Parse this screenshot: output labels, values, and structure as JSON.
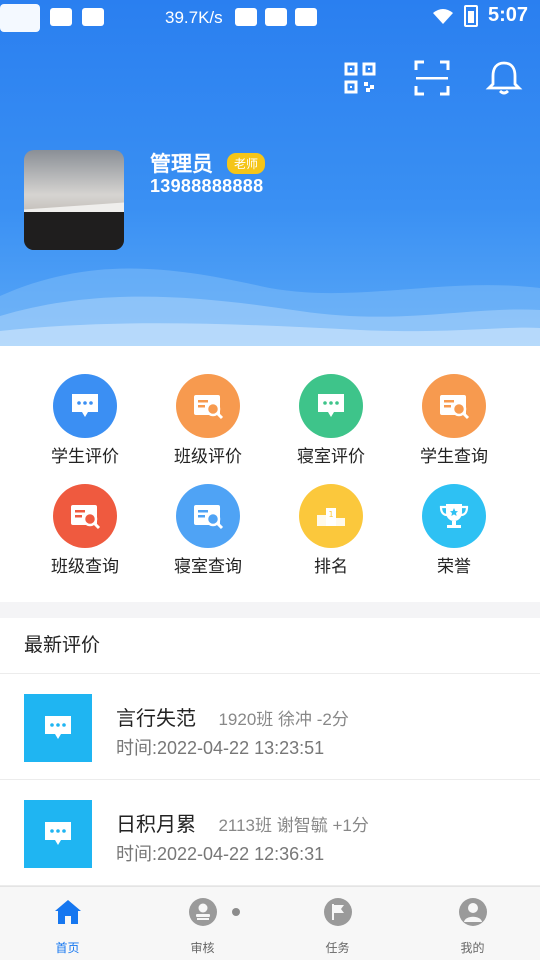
{
  "status_bar": {
    "speed": "39.7K/s",
    "time": "5:07"
  },
  "profile": {
    "name": "管理员",
    "role_badge": "老师",
    "phone": "13988888888"
  },
  "menu": [
    {
      "label": "学生评价",
      "icon": "chat-icon",
      "color": "#3b8ff3"
    },
    {
      "label": "班级评价",
      "icon": "doc-search-icon",
      "color": "#f79a4f"
    },
    {
      "label": "寝室评价",
      "icon": "chat-icon",
      "color": "#3ec48a"
    },
    {
      "label": "学生查询",
      "icon": "doc-search-icon",
      "color": "#f79a4f"
    },
    {
      "label": "班级查询",
      "icon": "doc-search-icon",
      "color": "#ef5a3f"
    },
    {
      "label": "寝室查询",
      "icon": "doc-search-icon",
      "color": "#4fa3f5"
    },
    {
      "label": "排名",
      "icon": "podium-icon",
      "color": "#fbc83c"
    },
    {
      "label": "荣誉",
      "icon": "trophy-icon",
      "color": "#2ec1f3"
    }
  ],
  "reviews": {
    "title": "最新评价",
    "items": [
      {
        "title": "言行失范",
        "meta": "1920班   徐冲   -2分",
        "time": "时间:2022-04-22 13:23:51"
      },
      {
        "title": "日积月累",
        "meta": "2113班   谢智毓   +1分",
        "time": "时间:2022-04-22 12:36:31"
      }
    ]
  },
  "tabs": [
    {
      "label": "首页",
      "icon": "home-icon",
      "active": true
    },
    {
      "label": "审核",
      "icon": "stamp-icon",
      "active": false
    },
    {
      "label": "任务",
      "icon": "flag-icon",
      "active": false
    },
    {
      "label": "我的",
      "icon": "user-icon",
      "active": false
    }
  ],
  "colors": {
    "header_blue": "#2a7ff0",
    "active_tab": "#1677f0",
    "badge_yellow": "#f5c518",
    "review_thumb": "#1fb5f2"
  }
}
